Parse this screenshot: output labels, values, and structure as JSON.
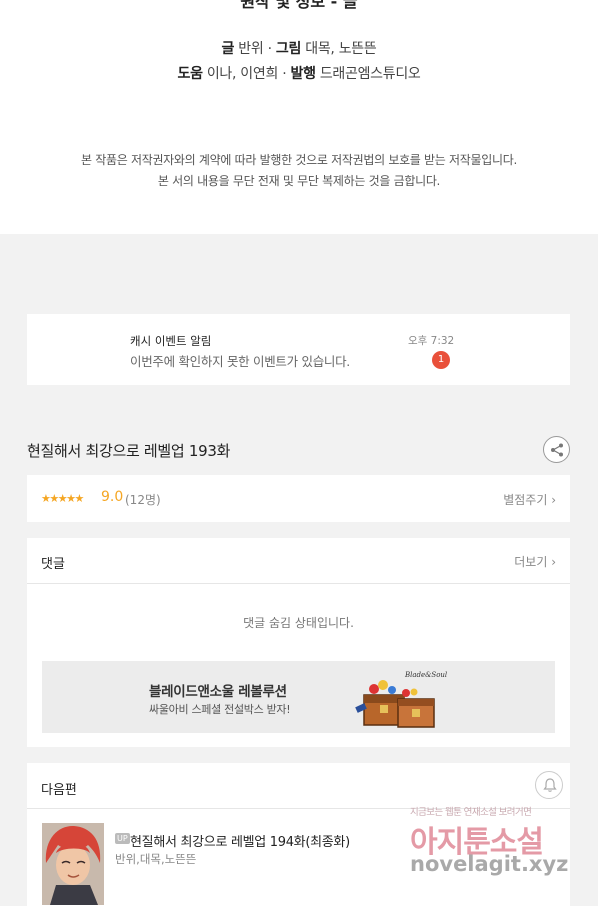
{
  "credits": {
    "cut_title": "원작 및 정보 - 글",
    "line1": {
      "label_a": "글",
      "value_a": "반위",
      "label_b": "그림",
      "value_b": "대목, 노뜬뜬"
    },
    "line2": {
      "label_a": "도움",
      "value_a": "이나, 이연희",
      "label_b": "발행",
      "value_b": "드래곤엠스튜디오"
    },
    "separator": "·",
    "notice_1": "본 작품은 저작권자와의 계약에 따라 발행한 것으로 저작권법의 보호를 받는 저작물입니다.",
    "notice_2": "본 서의 내용을 무단 전재 및 무단 복제하는 것을 금합니다."
  },
  "notification": {
    "title": "캐시 이벤트 알림",
    "text": "이번주에 확인하지 못한 이벤트가 있습니다.",
    "time": "오후 7:32",
    "badge": "1"
  },
  "episode": {
    "title": "현질해서 최강으로 레벨업 193화",
    "share_icon": "share-icon"
  },
  "rating": {
    "stars": "★★★★★",
    "score": "9.0",
    "count": "(12명)",
    "rate_label": "별점주기 ›",
    "stars_value": 4.5
  },
  "comments": {
    "label": "댓글",
    "more": "더보기 ›",
    "hidden_text": "댓글 숨김 상태입니다."
  },
  "banner": {
    "title": "블레이드앤소울 레볼루션",
    "subtitle": "싸울아비 스페셜 전설박스 받자!",
    "logo_text": "Blade&Soul 레볼루션"
  },
  "next": {
    "label": "다음편",
    "up_badge": "UP",
    "title": "현질해서 최강으로 레벨업 194화(최종화)",
    "authors": "반위,대목,노뜬뜬",
    "bell_icon": "bell-icon"
  },
  "watermark": {
    "top": "지금보는 웹툰 연재소설 보려거면",
    "main": "아지툰소설",
    "domain": "novelagit.xyz"
  },
  "colors": {
    "accent_orange": "#f5a623",
    "badge_red": "#e9503a",
    "watermark_pink": "#e49aa6"
  }
}
